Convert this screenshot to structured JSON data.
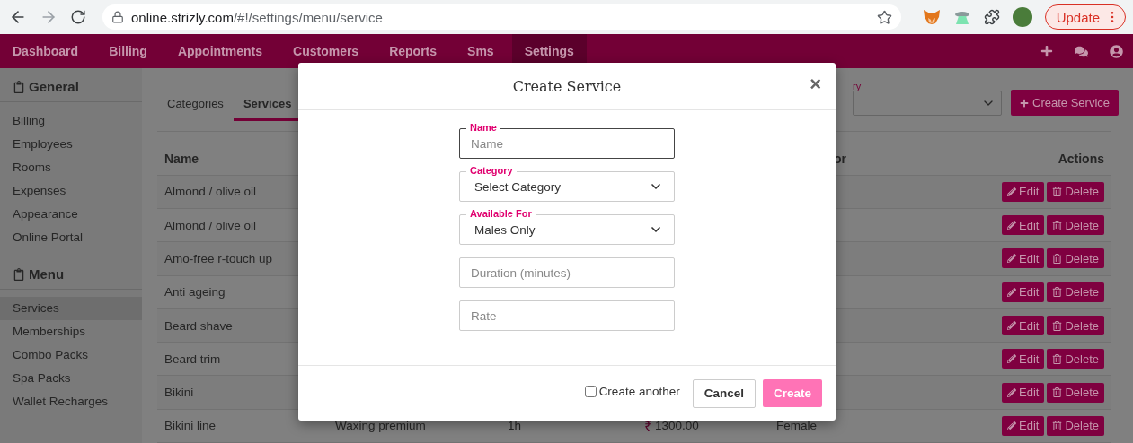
{
  "browser": {
    "url_host": "online.strizly.com",
    "url_path": "/#!/settings/menu/service",
    "update_button": "Update"
  },
  "nav": {
    "items": [
      {
        "label": "Dashboard",
        "selected": false
      },
      {
        "label": "Billing",
        "selected": false
      },
      {
        "label": "Appointments",
        "selected": false
      },
      {
        "label": "Customers",
        "selected": false
      },
      {
        "label": "Reports",
        "selected": false
      },
      {
        "label": "Sms",
        "selected": false
      },
      {
        "label": "Settings",
        "selected": true
      }
    ]
  },
  "sidebar": {
    "sections": [
      {
        "title": "General",
        "items": [
          {
            "label": "Billing",
            "selected": false
          },
          {
            "label": "Employees",
            "selected": false
          },
          {
            "label": "Rooms",
            "selected": false
          },
          {
            "label": "Expenses",
            "selected": false
          },
          {
            "label": "Appearance",
            "selected": false
          },
          {
            "label": "Online Portal",
            "selected": false
          }
        ]
      },
      {
        "title": "Menu",
        "items": [
          {
            "label": "Services",
            "selected": true
          },
          {
            "label": "Memberships",
            "selected": false
          },
          {
            "label": "Combo Packs",
            "selected": false
          },
          {
            "label": "Spa Packs",
            "selected": false
          },
          {
            "label": "Wallet Recharges",
            "selected": false
          }
        ]
      }
    ]
  },
  "tabs": [
    {
      "label": "Categories",
      "selected": false
    },
    {
      "label": "Services",
      "selected": true
    }
  ],
  "filter": {
    "label": "ry"
  },
  "create_button": "Create Service",
  "table": {
    "header": {
      "name": "Name",
      "column_5": "or",
      "actions": "Actions"
    },
    "rows": [
      {
        "name": "Almond / olive oil",
        "edit": "Edit",
        "delete": "Delete"
      },
      {
        "name": "Almond / olive oil",
        "edit": "Edit",
        "delete": "Delete"
      },
      {
        "name": "Amo-free r-touch up",
        "edit": "Edit",
        "delete": "Delete"
      },
      {
        "name": "Anti ageing",
        "edit": "Edit",
        "delete": "Delete"
      },
      {
        "name": "Beard shave",
        "edit": "Edit",
        "delete": "Delete"
      },
      {
        "name": "Beard trim",
        "edit": "Edit",
        "delete": "Delete"
      },
      {
        "name": "Bikini",
        "edit": "Edit",
        "delete": "Delete"
      },
      {
        "name": "Bikini line",
        "category": "Waxing premium",
        "duration": "1h",
        "currency": "₹",
        "rate": "1300.00",
        "available_for": "Female",
        "edit": "Edit",
        "delete": "Delete"
      }
    ]
  },
  "modal": {
    "title": "Create Service",
    "close": "×",
    "fields": [
      {
        "kind": "input",
        "label": "Name",
        "placeholder": "Name",
        "focused": true
      },
      {
        "kind": "select",
        "label": "Category",
        "value": "Select Category",
        "focused": false
      },
      {
        "kind": "select",
        "label": "Available For",
        "value": "Males Only",
        "focused": false
      },
      {
        "kind": "input",
        "placeholder": "Duration (minutes)",
        "focused": false
      },
      {
        "kind": "input",
        "placeholder": "Rate",
        "focused": false
      }
    ],
    "create_another": {
      "label": "Create another",
      "checked": false
    },
    "cancel": "Cancel",
    "submit": {
      "label": "Create",
      "disabled": true
    }
  }
}
